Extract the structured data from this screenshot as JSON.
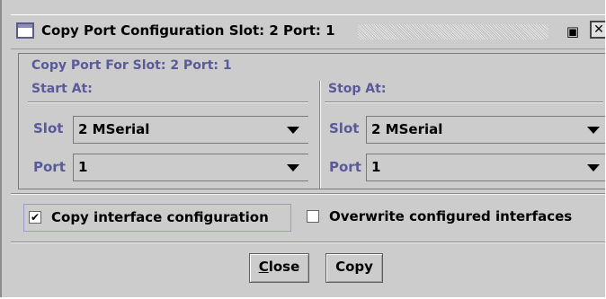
{
  "window": {
    "title": "Copy Port Configuration Slot: 2 Port: 1",
    "restore_glyph": "▣",
    "close_glyph": "✕"
  },
  "panel": {
    "title": "Copy Port For Slot: 2 Port: 1"
  },
  "start": {
    "title": "Start At:",
    "slot_label": "Slot",
    "slot_value": "2 MSerial",
    "port_label": "Port",
    "port_value": "1"
  },
  "stop": {
    "title": "Stop At:",
    "slot_label": "Slot",
    "slot_value": "2 MSerial",
    "port_label": "Port",
    "port_value": "1"
  },
  "options": {
    "copy_interface": {
      "label": "Copy interface configuration",
      "checked": true,
      "check_glyph": "✔"
    },
    "overwrite": {
      "label": "Overwrite configured interfaces",
      "checked": false
    }
  },
  "buttons": {
    "close_mnemonic": "C",
    "close_rest": "lose",
    "copy": "Copy"
  }
}
